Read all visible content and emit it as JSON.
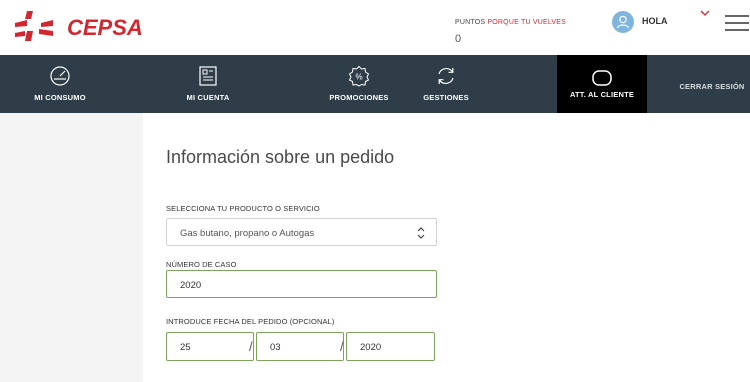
{
  "header": {
    "brand": "CEPSA",
    "points_label": "PUNTOS",
    "points_highlight": "PORQUE TU VUELVES",
    "points_value": "0",
    "greeting": "HOLA",
    "brand_color": "#d3272f"
  },
  "nav": {
    "items": [
      {
        "label": "MI CONSUMO",
        "icon": "gauge-icon"
      },
      {
        "label": "MI CUENTA",
        "icon": "document-icon"
      },
      {
        "label": "PROMOCIONES",
        "icon": "percent-badge-icon"
      },
      {
        "label": "GESTIONES",
        "icon": "refresh-icon"
      },
      {
        "label": "ATT. AL CLIENTE",
        "icon": "chat-bubble-icon",
        "active": true
      },
      {
        "label": "CERRAR SESIÓN",
        "icon": ""
      }
    ]
  },
  "form": {
    "title": "Información sobre un pedido",
    "product_label": "SELECCIONA TU PRODUCTO O SERVICIO",
    "product_value": "Gas butano, propano o Autogas",
    "case_label": "NÚMERO DE CASO",
    "case_value": "2020",
    "date_label": "INTRODUCE FECHA DEL PEDIDO (OPCIONAL)",
    "date_day": "25",
    "date_month": "03",
    "date_year": "2020",
    "date_separator": "/"
  }
}
